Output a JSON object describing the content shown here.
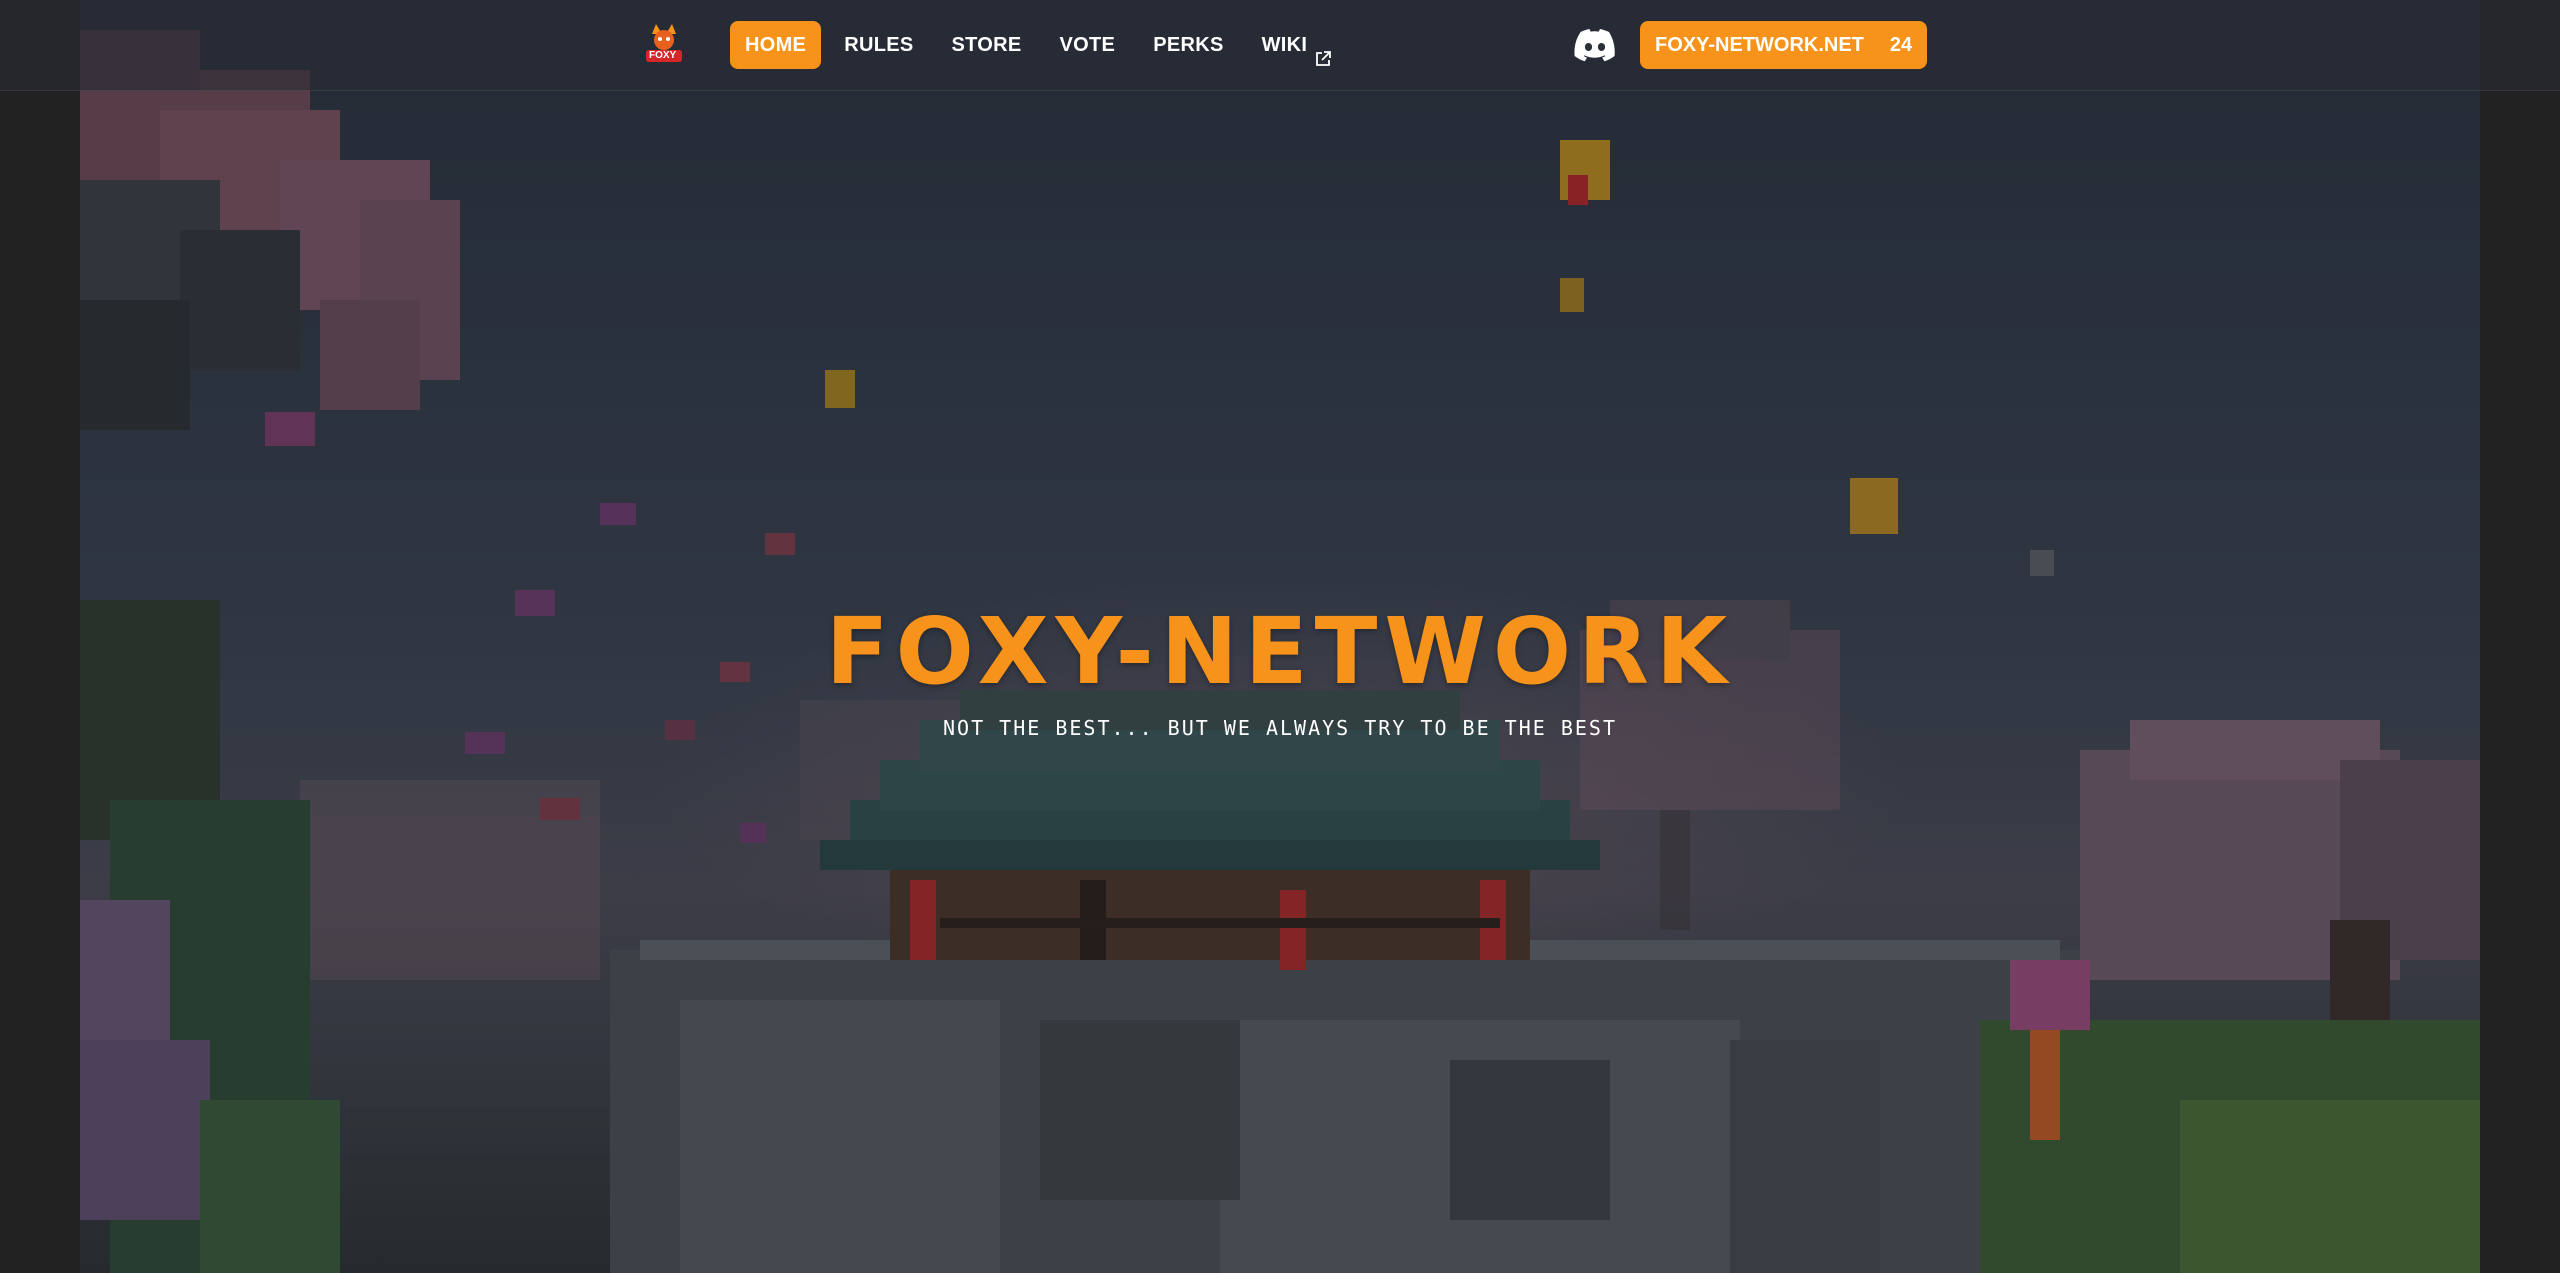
{
  "brand": {
    "logo_icon": "foxy-logo-icon",
    "logo_text": "FOXY",
    "accent_color": "#f7931a"
  },
  "nav": {
    "items": [
      {
        "label": "HOME",
        "active": true
      },
      {
        "label": "RULES",
        "active": false
      },
      {
        "label": "STORE",
        "active": false
      },
      {
        "label": "VOTE",
        "active": false
      },
      {
        "label": "PERKS",
        "active": false
      },
      {
        "label": "WIKI",
        "active": false,
        "icon": "external-link-icon"
      }
    ]
  },
  "actions": {
    "discord_icon": "discord-icon",
    "server_address": "FOXY-NETWORK.NET",
    "player_count": "24"
  },
  "hero": {
    "title": "FOXY-NETWORK",
    "subtitle": "NOT THE BEST... BUT WE ALWAYS TRY TO BE THE BEST",
    "background": "minecraft-temple-scene"
  }
}
